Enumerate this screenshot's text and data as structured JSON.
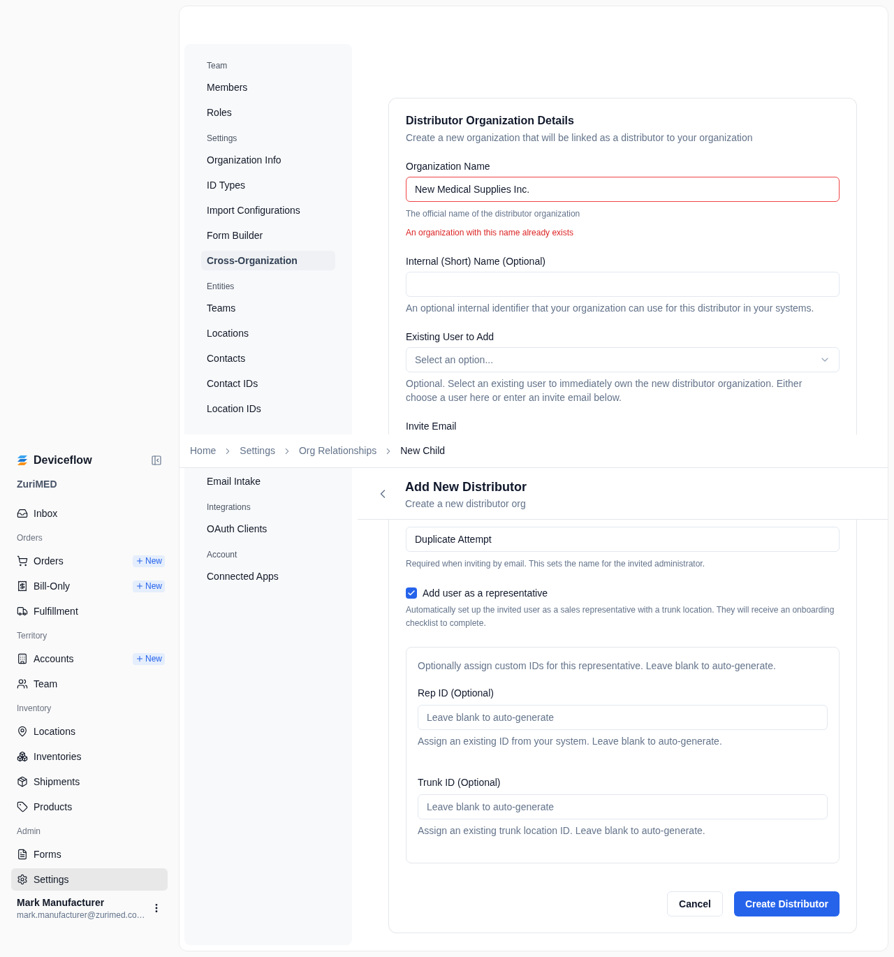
{
  "sidebar": {
    "brand": "Deviceflow",
    "organization": "ZuriMED",
    "items": [
      {
        "kind": "item",
        "label": "Inbox",
        "selected": false
      },
      {
        "kind": "group",
        "label": "Orders"
      },
      {
        "kind": "item",
        "label": "Orders",
        "badge": "New",
        "selected": false
      },
      {
        "kind": "item",
        "label": "Bill-Only",
        "badge": "New",
        "selected": false
      },
      {
        "kind": "item",
        "label": "Fulfillment",
        "selected": false
      },
      {
        "kind": "group",
        "label": "Territory"
      },
      {
        "kind": "item",
        "label": "Accounts",
        "badge": "New",
        "selected": false
      },
      {
        "kind": "item",
        "label": "Team",
        "selected": false
      },
      {
        "kind": "group",
        "label": "Inventory"
      },
      {
        "kind": "item",
        "label": "Locations",
        "selected": false
      },
      {
        "kind": "item",
        "label": "Inventories",
        "selected": false
      },
      {
        "kind": "item",
        "label": "Shipments",
        "selected": false
      },
      {
        "kind": "item",
        "label": "Products",
        "selected": false
      },
      {
        "kind": "group",
        "label": "Admin"
      },
      {
        "kind": "item",
        "label": "Forms",
        "selected": false
      },
      {
        "kind": "item",
        "label": "Settings",
        "selected": true
      }
    ],
    "user": {
      "name": "Mark Manufacturer",
      "email": "mark.manufacturer@zurimed.co…"
    }
  },
  "settings_nav": {
    "upper": [
      {
        "kind": "group",
        "label": "Team"
      },
      {
        "kind": "item",
        "label": "Members",
        "selected": false
      },
      {
        "kind": "item",
        "label": "Roles",
        "selected": false
      },
      {
        "kind": "group",
        "label": "Settings"
      },
      {
        "kind": "item",
        "label": "Organization Info",
        "selected": false
      },
      {
        "kind": "item",
        "label": "ID Types",
        "selected": false
      },
      {
        "kind": "item",
        "label": "Import Configurations",
        "selected": false
      },
      {
        "kind": "item",
        "label": "Form Builder",
        "selected": false
      },
      {
        "kind": "item",
        "label": "Cross-Organization",
        "selected": true
      },
      {
        "kind": "group",
        "label": "Entities"
      },
      {
        "kind": "item",
        "label": "Teams",
        "selected": false
      },
      {
        "kind": "item",
        "label": "Locations",
        "selected": false
      },
      {
        "kind": "item",
        "label": "Contacts",
        "selected": false
      },
      {
        "kind": "item",
        "label": "Contact IDs",
        "selected": false
      },
      {
        "kind": "item",
        "label": "Location IDs",
        "selected": false
      }
    ],
    "lower": [
      {
        "kind": "item",
        "label": "Email Intake",
        "selected": false
      },
      {
        "kind": "group",
        "label": "Integrations"
      },
      {
        "kind": "item",
        "label": "OAuth Clients",
        "selected": false
      },
      {
        "kind": "group",
        "label": "Account"
      },
      {
        "kind": "item",
        "label": "Connected Apps",
        "selected": false
      }
    ]
  },
  "breadcrumb": [
    {
      "label": "Home",
      "current": false
    },
    {
      "label": "Settings",
      "current": false
    },
    {
      "label": "Org Relationships",
      "current": false
    },
    {
      "label": "New Child",
      "current": true
    }
  ],
  "page_header": {
    "title": "Add New Distributor",
    "subtitle": "Create a new distributor org"
  },
  "form": {
    "title": "Distributor Organization Details",
    "subtitle": "Create a new organization that will be linked as a distributor to your organization",
    "organization_name": {
      "label": "Organization Name",
      "value": "New Medical Supplies Inc.",
      "help": "The official name of the distributor organization",
      "error": "An organization with this name already exists"
    },
    "internal_name": {
      "label": "Internal (Short) Name (Optional)",
      "help": "An optional internal identifier that your organization can use for this distributor in your systems."
    },
    "existing_user": {
      "label": "Existing User to Add",
      "placeholder": "Select an option...",
      "help": "Optional. Select an existing user to immediately own the new distributor organization. Either choose a user here or enter an invite email below."
    },
    "invite_email": {
      "label": "Invite Email"
    },
    "invite_name": {
      "value": "Duplicate Attempt",
      "help": "Required when inviting by email. This sets the name for the invited administrator."
    },
    "representative": {
      "label": "Add user as a representative",
      "checked": true,
      "help": "Automatically set up the invited user as a sales representative with a trunk location. They will receive an onboarding checklist to complete."
    },
    "custom_ids": {
      "intro": "Optionally assign custom IDs for this representative. Leave blank to auto-generate.",
      "fields": [
        {
          "label": "Rep ID (Optional)",
          "placeholder": "Leave blank to auto-generate",
          "help": "Assign an existing ID from your system. Leave blank to auto-generate."
        },
        {
          "label": "Trunk ID (Optional)",
          "placeholder": "Leave blank to auto-generate",
          "help": "Assign an existing trunk location ID. Leave blank to auto-generate."
        }
      ]
    },
    "buttons": [
      {
        "label": "Cancel",
        "kind": "secondary"
      },
      {
        "label": "Create Distributor",
        "kind": "primary"
      }
    ]
  }
}
